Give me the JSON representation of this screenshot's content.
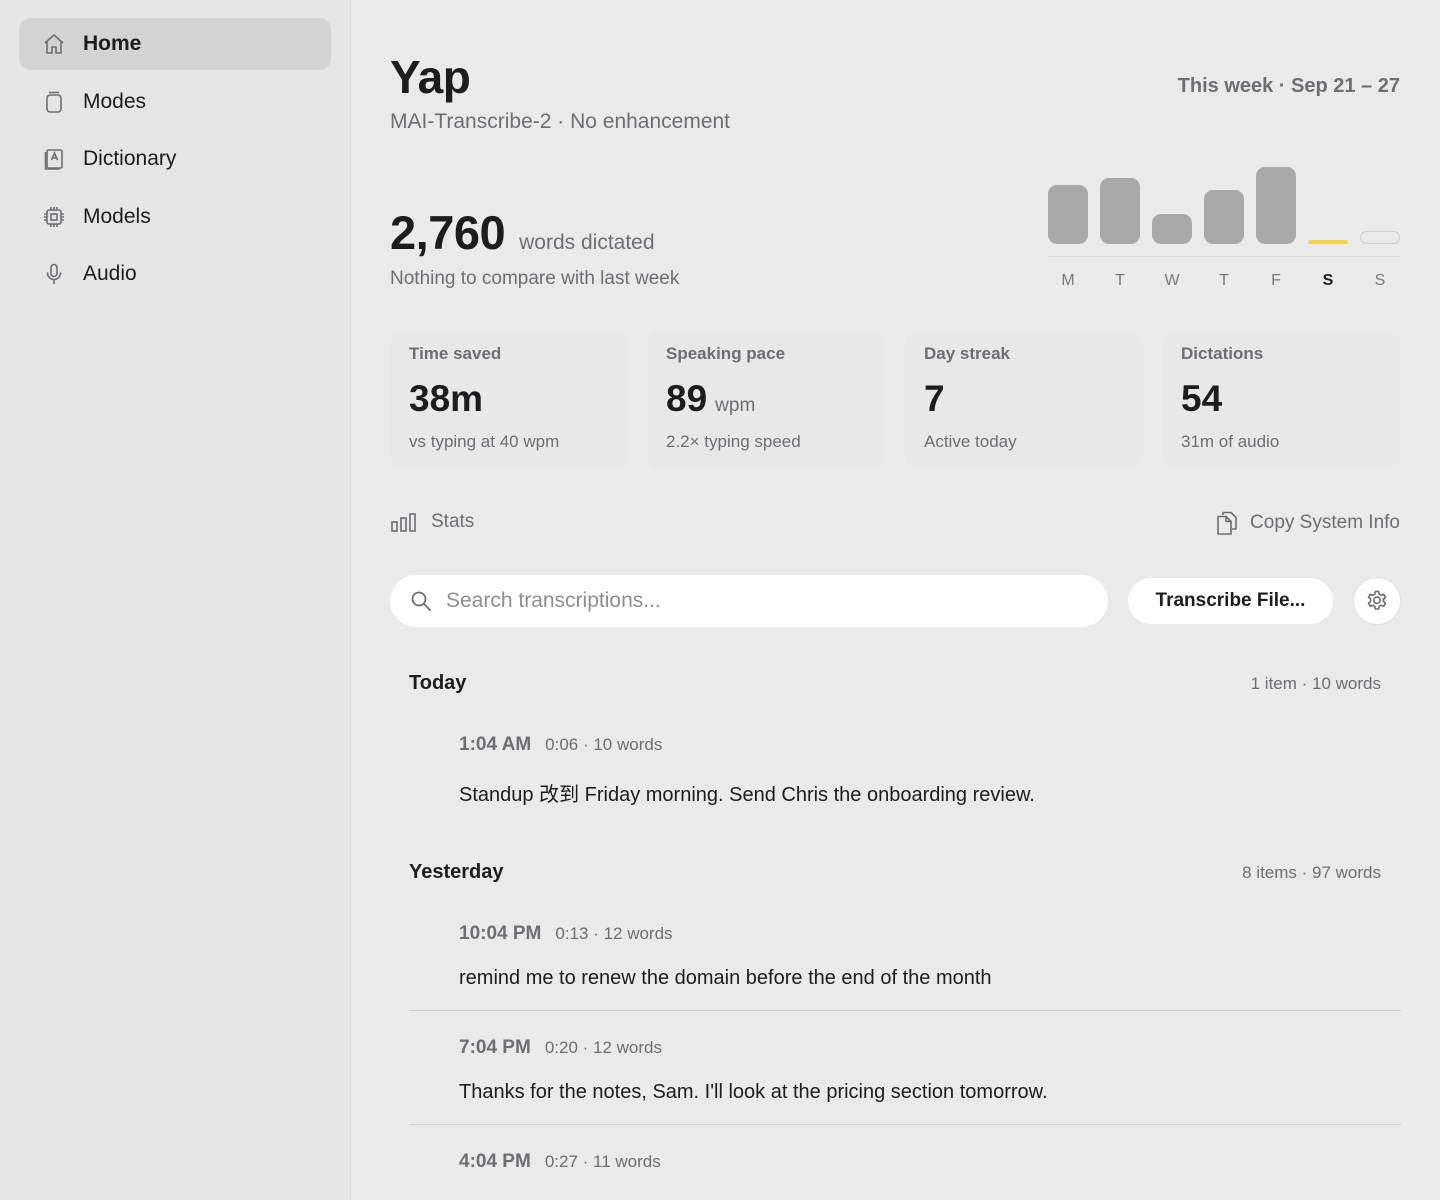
{
  "sidebar": {
    "items": [
      {
        "label": "Home",
        "icon": "home-icon",
        "active": true
      },
      {
        "label": "Modes",
        "icon": "modes-icon"
      },
      {
        "label": "Dictionary",
        "icon": "dictionary-icon"
      },
      {
        "label": "Models",
        "icon": "chip-icon"
      },
      {
        "label": "Audio",
        "icon": "microphone-icon"
      }
    ]
  },
  "header": {
    "title": "Yap",
    "subtitle": "MAI-Transcribe-2 · No enhancement",
    "week_range": "This week · Sep 21 – 27"
  },
  "summary": {
    "words_count": "2,760",
    "words_label": "words dictated",
    "compare_note": "Nothing to compare with last week"
  },
  "week_chart": {
    "days": [
      "M",
      "T",
      "W",
      "T",
      "F",
      "S",
      "S"
    ],
    "relative_values": [
      0.76,
      0.86,
      0.39,
      0.7,
      1.0,
      0.02,
      0
    ],
    "today_index": 5,
    "future_index": 6,
    "bar_color": "#a9a9a9",
    "today_color": "#f3d24a"
  },
  "stats": [
    {
      "label": "Time saved",
      "value": "38m",
      "unit": "",
      "note": "vs typing at 40 wpm"
    },
    {
      "label": "Speaking pace",
      "value": "89",
      "unit": "wpm",
      "note": "2.2× typing speed"
    },
    {
      "label": "Day streak",
      "value": "7",
      "unit": "",
      "note": "Active today"
    },
    {
      "label": "Dictations",
      "value": "54",
      "unit": "",
      "note": "31m of audio"
    }
  ],
  "toolbar": {
    "stats_label": "Stats",
    "copy_info_label": "Copy System Info"
  },
  "search": {
    "placeholder": "Search transcriptions...",
    "value": ""
  },
  "actions": {
    "transcribe_label": "Transcribe File..."
  },
  "groups": [
    {
      "title": "Today",
      "meta": "1 item · 10 words",
      "entries": [
        {
          "time": "1:04 AM",
          "duration": "0:06 · 10 words",
          "text": "Standup 改到 Friday morning. Send Chris the onboarding review."
        }
      ]
    },
    {
      "title": "Yesterday",
      "meta": "8 items · 97 words",
      "entries": [
        {
          "time": "10:04 PM",
          "duration": "0:13 · 12 words",
          "text": "remind me to renew the domain before the end of the month"
        },
        {
          "time": "7:04 PM",
          "duration": "0:20 · 12 words",
          "text": "Thanks for the notes, Sam. I'll look at the pricing section tomorrow."
        },
        {
          "time": "4:04 PM",
          "duration": "0:27 · 11 words",
          "text": ""
        }
      ]
    }
  ]
}
